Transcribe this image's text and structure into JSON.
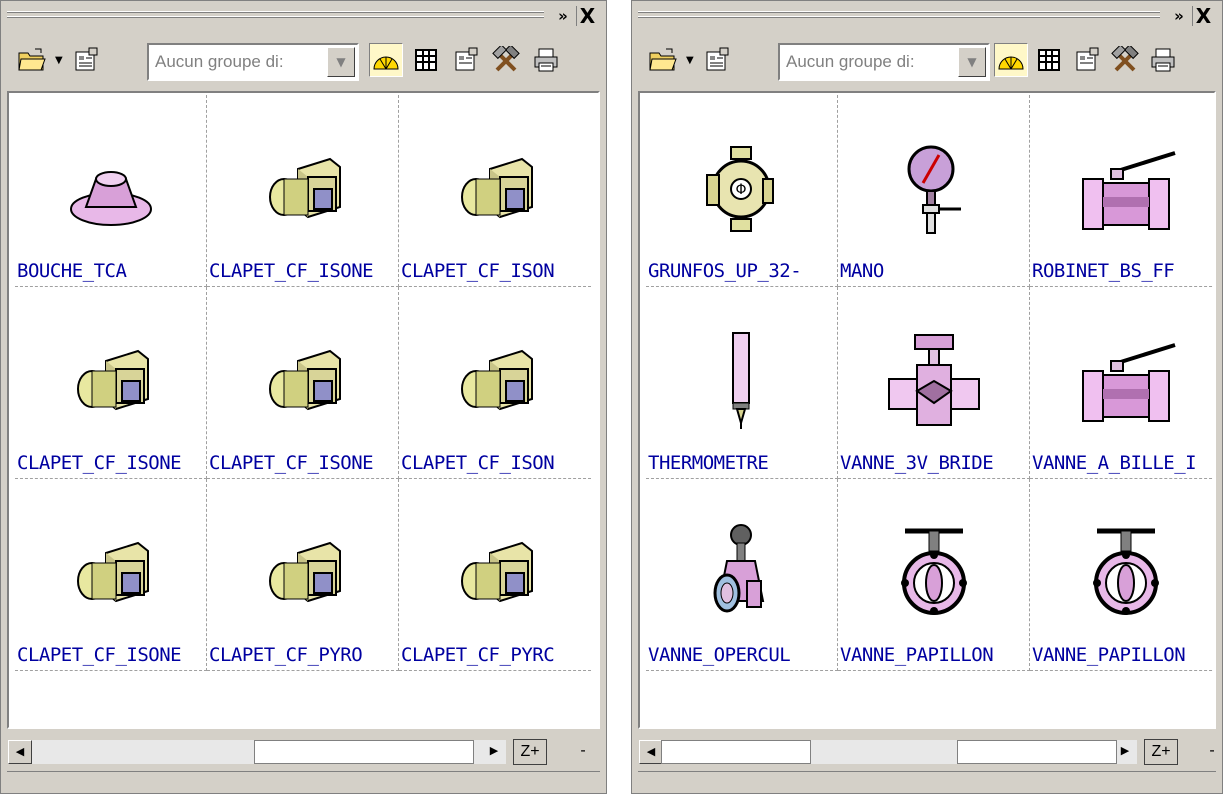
{
  "left": {
    "combo_text": "Aucun groupe di:",
    "zoom_label": "Z+",
    "minus_label": "-",
    "scroll_left": "◀",
    "scroll_right": "▶",
    "items": [
      {
        "label": "BOUCHE_TCA",
        "icon": "diffuser-cap-icon"
      },
      {
        "label": "CLAPET_CF_ISONE",
        "icon": "fire-damper-icon"
      },
      {
        "label": "CLAPET_CF_ISON",
        "icon": "fire-damper-icon"
      },
      {
        "label": "CLAPET_CF_ISONE",
        "icon": "fire-damper-icon"
      },
      {
        "label": "CLAPET_CF_ISONE",
        "icon": "fire-damper-icon"
      },
      {
        "label": "CLAPET_CF_ISON",
        "icon": "fire-damper-icon"
      },
      {
        "label": "CLAPET_CF_ISONE",
        "icon": "fire-damper-icon"
      },
      {
        "label": "CLAPET_CF_PYRO",
        "icon": "fire-damper-icon"
      },
      {
        "label": "CLAPET_CF_PYRC",
        "icon": "fire-damper-icon"
      }
    ]
  },
  "right": {
    "combo_text": "Aucun groupe di:",
    "zoom_label": "Z+",
    "minus_label": "-",
    "scroll_left": "◀",
    "scroll_right": "▶",
    "items": [
      {
        "label": "GRUNFOS_UP_32-",
        "icon": "pump-icon"
      },
      {
        "label": "MANO",
        "icon": "manometer-icon"
      },
      {
        "label": "ROBINET_BS_FF",
        "icon": "ball-valve-icon"
      },
      {
        "label": "THERMOMETRE",
        "icon": "thermometer-icon"
      },
      {
        "label": "VANNE_3V_BRIDE",
        "icon": "three-way-valve-icon"
      },
      {
        "label": "VANNE_A_BILLE_I",
        "icon": "ball-valve-icon"
      },
      {
        "label": "VANNE_OPERCUL",
        "icon": "gate-valve-icon"
      },
      {
        "label": "VANNE_PAPILLON",
        "icon": "butterfly-valve-icon"
      },
      {
        "label": "VANNE_PAPILLON",
        "icon": "butterfly-valve-icon"
      }
    ]
  },
  "chevron": "»",
  "close": "X"
}
